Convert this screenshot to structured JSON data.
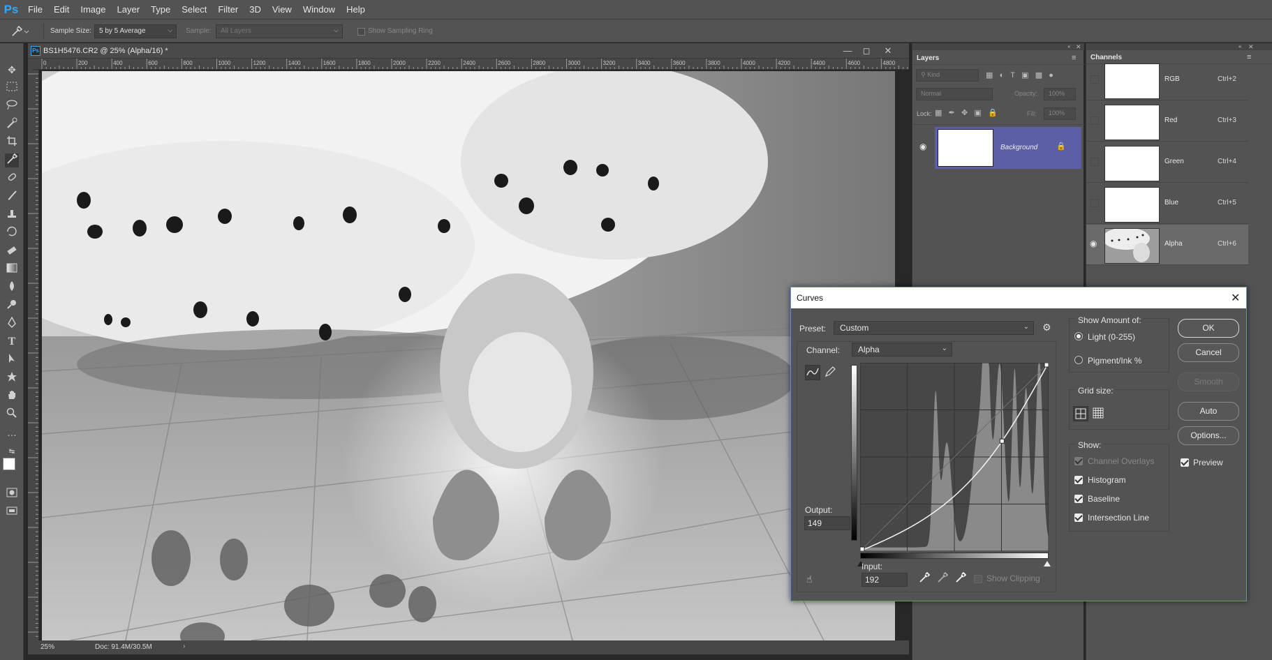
{
  "menu": {
    "logo": "Ps",
    "items": [
      "File",
      "Edit",
      "Image",
      "Layer",
      "Type",
      "Select",
      "Filter",
      "3D",
      "View",
      "Window",
      "Help"
    ]
  },
  "options_bar": {
    "sample_size_label": "Sample Size:",
    "sample_size_value": "5 by 5 Average",
    "sample_label": "Sample:",
    "sample_value": "All Layers",
    "show_ring_label": "Show Sampling Ring"
  },
  "document": {
    "title": "BS1H5476.CR2 @ 25% (Alpha/16) *",
    "ruler_ticks": [
      "0",
      "200",
      "400",
      "600",
      "800",
      "1000",
      "1200",
      "1400",
      "1600",
      "1800",
      "2000",
      "2200",
      "2400",
      "2600",
      "2800",
      "3000",
      "3200",
      "3400",
      "3600",
      "3800",
      "4000",
      "4200",
      "4400",
      "4600",
      "4800"
    ],
    "zoom": "25%",
    "doc_size": "Doc: 91.4M/30.5M"
  },
  "layers_panel": {
    "tab": "Layers",
    "kind_placeholder": "Kind",
    "blend_mode": "Normal",
    "opacity_label": "Opacity:",
    "opacity_value": "100%",
    "lock_label": "Lock:",
    "fill_label": "Fill:",
    "fill_value": "100%",
    "layer_name": "Background"
  },
  "channels_panel": {
    "tab": "Channels",
    "channels": [
      {
        "name": "RGB",
        "shortcut": "Ctrl+2",
        "visible": false
      },
      {
        "name": "Red",
        "shortcut": "Ctrl+3",
        "visible": false
      },
      {
        "name": "Green",
        "shortcut": "Ctrl+4",
        "visible": false
      },
      {
        "name": "Blue",
        "shortcut": "Ctrl+5",
        "visible": false
      },
      {
        "name": "Alpha",
        "shortcut": "Ctrl+6",
        "visible": true
      }
    ]
  },
  "curves": {
    "title": "Curves",
    "preset_label": "Preset:",
    "preset_value": "Custom",
    "channel_label": "Channel:",
    "channel_value": "Alpha",
    "output_label": "Output:",
    "output_value": "149",
    "input_label": "Input:",
    "input_value": "192",
    "show_clipping_label": "Show Clipping",
    "show_amount_label": "Show Amount of:",
    "light_label": "Light  (0-255)",
    "pigment_label": "Pigment/Ink %",
    "grid_size_label": "Grid size:",
    "show_label": "Show:",
    "channel_overlays_label": "Channel Overlays",
    "histogram_label": "Histogram",
    "baseline_label": "Baseline",
    "intersection_label": "Intersection Line",
    "ok_label": "OK",
    "cancel_label": "Cancel",
    "smooth_label": "Smooth",
    "auto_label": "Auto",
    "options_label": "Options...",
    "preview_label": "Preview",
    "curve_points": [
      [
        0,
        0
      ],
      [
        192,
        149
      ],
      [
        255,
        255
      ]
    ]
  }
}
